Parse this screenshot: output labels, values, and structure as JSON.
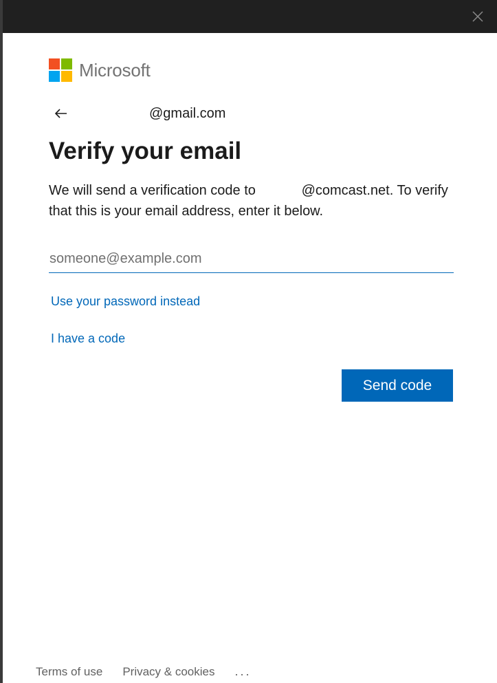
{
  "brand": {
    "name": "Microsoft",
    "colors": {
      "red": "#f25022",
      "green": "#7fba00",
      "blue": "#00a4ef",
      "yellow": "#ffb900"
    }
  },
  "titlebar": {
    "close_icon": "close-icon"
  },
  "identity": {
    "email": "@gmail.com",
    "back_icon": "arrow-left-icon"
  },
  "title": "Verify your email",
  "description": "We will send a verification code to            @comcast.net. To verify that this is your email address, enter it below.",
  "email_input": {
    "placeholder": "someone@example.com",
    "value": ""
  },
  "links": {
    "use_password": "Use your password instead",
    "have_code": "I have a code"
  },
  "send_button": "Send code",
  "accent_color": "#0067b8",
  "footer": {
    "terms": "Terms of use",
    "privacy": "Privacy & cookies",
    "more": "..."
  }
}
